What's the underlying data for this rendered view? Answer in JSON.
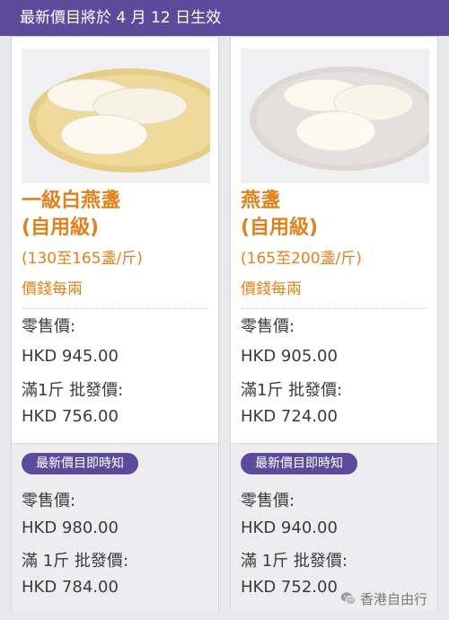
{
  "banner": {
    "text": "最新價目將於 4 月 12 日生效"
  },
  "products": [
    {
      "name_line1": "一級白燕盞",
      "name_line2": "(自用級)",
      "range": "(130至165盞/斤)",
      "per_unit": "價錢每兩",
      "current": {
        "retail_label": "零售價:",
        "retail_value": "HKD 945.00",
        "wholesale_label": "滿1斤 批發價:",
        "wholesale_value": "HKD 756.00"
      },
      "badge": "最新價目即時知",
      "new": {
        "retail_label": "零售價:",
        "retail_value": "HKD 980.00",
        "wholesale_label": "滿 1斤 批發價:",
        "wholesale_value": "HKD 784.00"
      }
    },
    {
      "name_line1": "燕盞",
      "name_line2": "(自用級)",
      "range": "(165至200盞/斤)",
      "per_unit": "價錢每兩",
      "current": {
        "retail_label": "零售價:",
        "retail_value": "HKD 905.00",
        "wholesale_label": "滿1斤 批發價:",
        "wholesale_value": "HKD 724.00"
      },
      "badge": "最新價目即時知",
      "new": {
        "retail_label": "零售價:",
        "retail_value": "HKD 940.00",
        "wholesale_label": "滿 1斤 批發價:",
        "wholesale_value": "HKD 752.00"
      }
    }
  ],
  "watermark": {
    "text": "香港自由行",
    "icon": "wechat-icon"
  },
  "colors": {
    "accent": "#5b4b9a",
    "product_name": "#e0811a",
    "text": "#3a3a3a"
  }
}
